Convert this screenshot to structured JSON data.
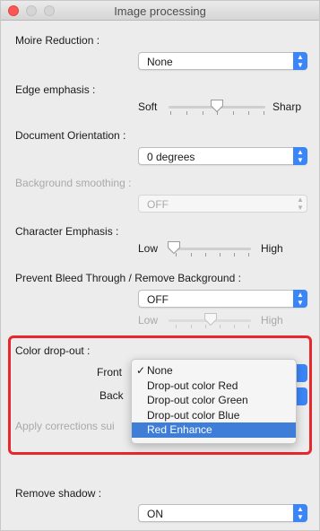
{
  "window": {
    "title": "Image processing"
  },
  "moire": {
    "label": "Moire Reduction :",
    "value": "None"
  },
  "edge": {
    "label": "Edge emphasis :",
    "min_label": "Soft",
    "max_label": "Sharp",
    "level": 0.5
  },
  "orientation": {
    "label": "Document Orientation :",
    "value": "0 degrees"
  },
  "background_smoothing": {
    "label": "Background smoothing :",
    "value": "OFF"
  },
  "character": {
    "label": "Character Emphasis :",
    "min_label": "Low",
    "max_label": "High",
    "level": 0.0
  },
  "bleed": {
    "label": "Prevent Bleed Through / Remove Background :",
    "value": "OFF",
    "min_label": "Low",
    "max_label": "High",
    "level": 0.5
  },
  "dropout": {
    "label": "Color drop-out :",
    "front_label": "Front",
    "back_label": "Back",
    "apply_label": "Apply corrections sui",
    "menu_items": [
      {
        "label": "None",
        "checked": true,
        "selected": false
      },
      {
        "label": "Drop-out color Red",
        "checked": false,
        "selected": false
      },
      {
        "label": "Drop-out color Green",
        "checked": false,
        "selected": false
      },
      {
        "label": "Drop-out color Blue",
        "checked": false,
        "selected": false
      },
      {
        "label": "Red Enhance",
        "checked": false,
        "selected": true
      }
    ],
    "check_glyph": "✓",
    "highlight_color": "#e8262d"
  },
  "shadow": {
    "label": "Remove shadow :",
    "value": "ON"
  },
  "colors": {
    "accent": "#3b86f7",
    "menu_selected": "#3e7ed8"
  }
}
